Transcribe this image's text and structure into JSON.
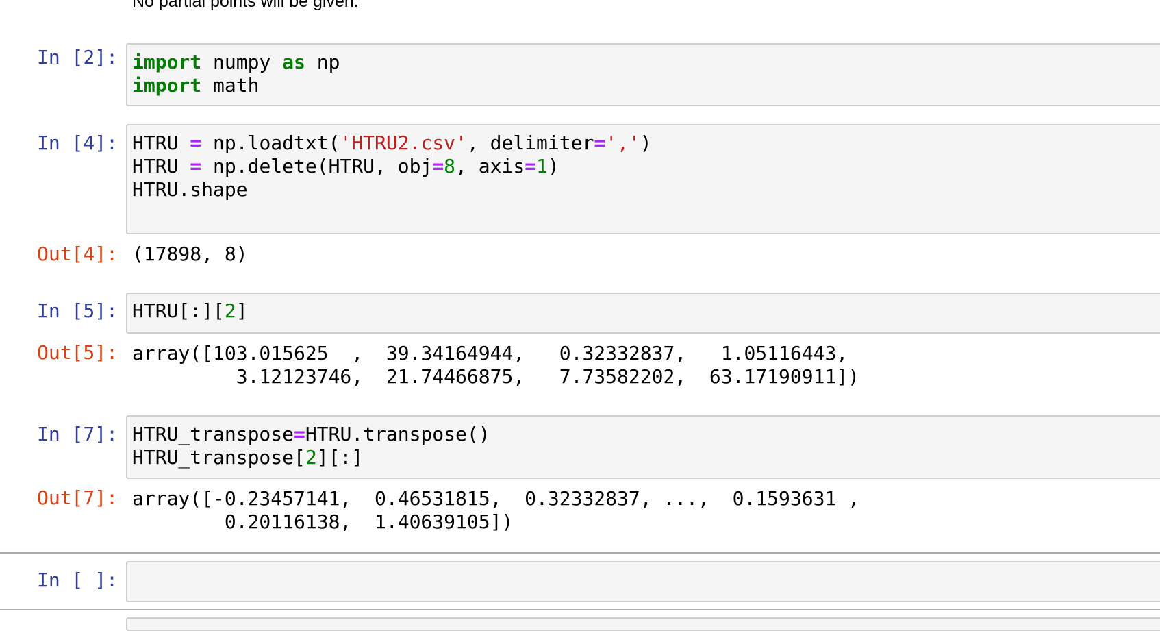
{
  "markdown": {
    "text": "No partial points will be given."
  },
  "cells": [
    {
      "prompt": "In [2]:",
      "lines": [
        [
          {
            "t": "import",
            "c": "kw"
          },
          {
            "t": " numpy "
          },
          {
            "t": "as",
            "c": "kw"
          },
          {
            "t": " np"
          }
        ],
        [
          {
            "t": "import",
            "c": "kw"
          },
          {
            "t": " math"
          }
        ]
      ]
    },
    {
      "prompt": "In [4]:",
      "lines": [
        [
          {
            "t": "HTRU "
          },
          {
            "t": "=",
            "c": "op"
          },
          {
            "t": " np.loadtxt("
          },
          {
            "t": "'HTRU2.csv'",
            "c": "str"
          },
          {
            "t": ", delimiter"
          },
          {
            "t": "=",
            "c": "op"
          },
          {
            "t": "','",
            "c": "str"
          },
          {
            "t": ")"
          }
        ],
        [
          {
            "t": "HTRU "
          },
          {
            "t": "=",
            "c": "op"
          },
          {
            "t": " np.delete(HTRU, obj"
          },
          {
            "t": "=",
            "c": "op"
          },
          {
            "t": "8",
            "c": "num"
          },
          {
            "t": ", axis"
          },
          {
            "t": "=",
            "c": "op"
          },
          {
            "t": "1",
            "c": "num"
          },
          {
            "t": ")"
          }
        ],
        [
          {
            "t": "HTRU.shape"
          }
        ]
      ],
      "out_prompt": "Out[4]:",
      "output": "(17898, 8)"
    },
    {
      "prompt": "In [5]:",
      "lines": [
        [
          {
            "t": "HTRU[:]["
          },
          {
            "t": "2",
            "c": "num"
          },
          {
            "t": "]"
          }
        ]
      ],
      "out_prompt": "Out[5]:",
      "output": "array([103.015625  ,  39.34164944,   0.32332837,   1.05116443,\n         3.12123746,  21.74466875,   7.73582202,  63.17190911])"
    },
    {
      "prompt": "In [7]:",
      "lines": [
        [
          {
            "t": "HTRU_transpose"
          },
          {
            "t": "=",
            "c": "op"
          },
          {
            "t": "HTRU.transpose()"
          }
        ],
        [
          {
            "t": "HTRU_transpose["
          },
          {
            "t": "2",
            "c": "num"
          },
          {
            "t": "][:]"
          }
        ]
      ],
      "out_prompt": "Out[7]:",
      "output": "array([-0.23457141,  0.46531815,  0.32332837, ...,  0.1593631 ,\n        0.20116138,  1.40639105])"
    },
    {
      "prompt": "In [ ]:",
      "lines": []
    }
  ],
  "colors": {
    "in_prompt": "#303f9f",
    "out_prompt": "#d84315",
    "keyword": "#008000",
    "operator": "#aa22ff",
    "string": "#ba2121",
    "number": "#008000",
    "cell_background": "#f5f5f5"
  }
}
